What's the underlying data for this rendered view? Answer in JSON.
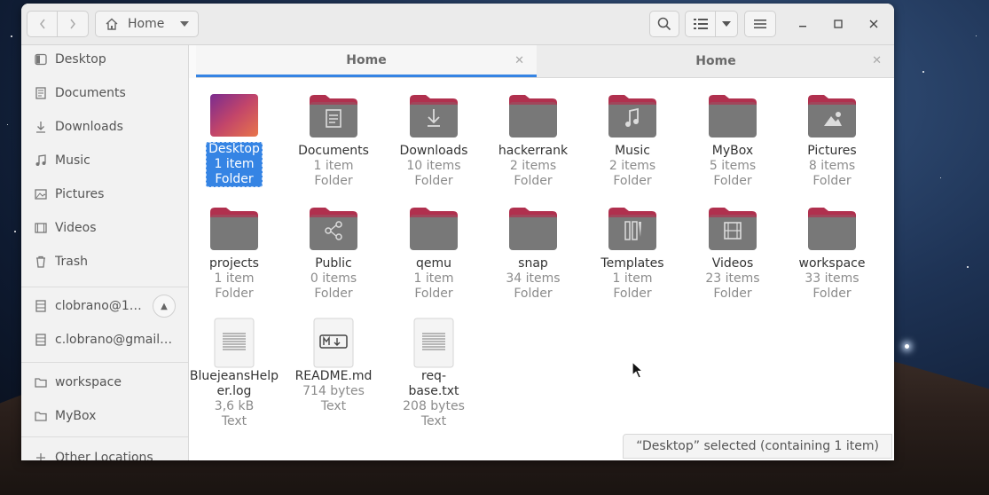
{
  "headerbar": {
    "back_icon": "chevron-left-icon",
    "forward_icon": "chevron-right-icon",
    "path_icon": "home-icon",
    "path_label": "Home",
    "search_icon": "search-icon",
    "view_icon": "list-view-icon",
    "menu_icon": "hamburger-icon"
  },
  "sidebar": {
    "places": [
      {
        "label": "Desktop",
        "icon": "desktop-icon"
      },
      {
        "label": "Documents",
        "icon": "document-icon"
      },
      {
        "label": "Downloads",
        "icon": "download-icon"
      },
      {
        "label": "Music",
        "icon": "music-icon"
      },
      {
        "label": "Pictures",
        "icon": "picture-icon"
      },
      {
        "label": "Videos",
        "icon": "video-icon"
      },
      {
        "label": "Trash",
        "icon": "trash-icon"
      }
    ],
    "devices": [
      {
        "label": "clobrano@1…",
        "icon": "network-drive-icon"
      },
      {
        "label": "c.lobrano@gmail.…",
        "icon": "network-drive-icon"
      }
    ],
    "bookmarks": [
      {
        "label": "workspace",
        "icon": "folder-icon"
      },
      {
        "label": "MyBox",
        "icon": "folder-icon"
      }
    ],
    "other_locations": "Other Locations"
  },
  "tabs": [
    {
      "label": "Home"
    },
    {
      "label": "Home"
    }
  ],
  "files": [
    {
      "name": "Desktop",
      "meta1": "1 item",
      "meta2": "Folder",
      "kind": "desktop"
    },
    {
      "name": "Documents",
      "meta1": "1 item",
      "meta2": "Folder",
      "kind": "documents"
    },
    {
      "name": "Downloads",
      "meta1": "10 items",
      "meta2": "Folder",
      "kind": "downloads"
    },
    {
      "name": "hackerrank",
      "meta1": "2 items",
      "meta2": "Folder",
      "kind": "folder"
    },
    {
      "name": "Music",
      "meta1": "2 items",
      "meta2": "Folder",
      "kind": "music"
    },
    {
      "name": "MyBox",
      "meta1": "5 items",
      "meta2": "Folder",
      "kind": "folder"
    },
    {
      "name": "Pictures",
      "meta1": "8 items",
      "meta2": "Folder",
      "kind": "pictures"
    },
    {
      "name": "projects",
      "meta1": "1 item",
      "meta2": "Folder",
      "kind": "folder"
    },
    {
      "name": "Public",
      "meta1": "0 items",
      "meta2": "Folder",
      "kind": "public"
    },
    {
      "name": "qemu",
      "meta1": "1 item",
      "meta2": "Folder",
      "kind": "folder"
    },
    {
      "name": "snap",
      "meta1": "34 items",
      "meta2": "Folder",
      "kind": "folder"
    },
    {
      "name": "Templates",
      "meta1": "1 item",
      "meta2": "Folder",
      "kind": "templates"
    },
    {
      "name": "Videos",
      "meta1": "23 items",
      "meta2": "Folder",
      "kind": "videos"
    },
    {
      "name": "workspace",
      "meta1": "33 items",
      "meta2": "Folder",
      "kind": "folder"
    },
    {
      "name": "BluejeansHelper.log",
      "name_line1": "BluejeansHelp",
      "name_line2": "er.log",
      "meta1": "3,6 kB",
      "meta2": "Text",
      "kind": "text"
    },
    {
      "name": "README.md",
      "meta1": "714 bytes",
      "meta2": "Text",
      "kind": "markdown"
    },
    {
      "name": "req-base.txt",
      "meta1": "208 bytes",
      "meta2": "Text",
      "kind": "text"
    }
  ],
  "status": "“Desktop” selected  (containing 1 item)",
  "colors": {
    "accent": "#3584e4",
    "folder_top": "#b0304e",
    "folder_body": "#787878"
  }
}
